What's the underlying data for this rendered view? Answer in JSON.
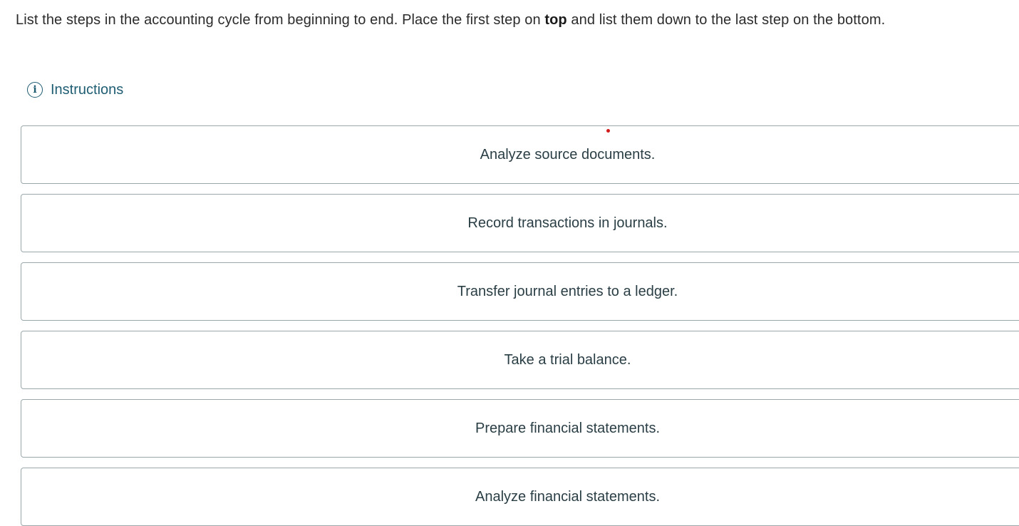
{
  "question": {
    "text_before": "List the steps in the accounting cycle from beginning to end. Place the first step on ",
    "text_bold": "top",
    "text_after": " and list them down to the last step on the bottom."
  },
  "instructions": {
    "label": "Instructions",
    "icon": "info-icon",
    "icon_glyph": "i",
    "color": "#1f5d73"
  },
  "steps": [
    {
      "label": "Analyze source documents."
    },
    {
      "label": "Record transactions in journals."
    },
    {
      "label": "Transfer journal entries to a ledger."
    },
    {
      "label": "Take a trial balance."
    },
    {
      "label": "Prepare financial statements."
    },
    {
      "label": "Analyze financial statements."
    }
  ],
  "colors": {
    "border": "#9aa7ab",
    "text": "#2a3e45",
    "marker": "#d11a1a"
  }
}
